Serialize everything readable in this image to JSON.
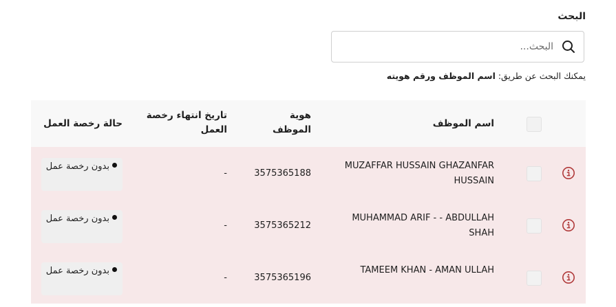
{
  "search": {
    "label": "البحث",
    "placeholder": "البحث...",
    "hint_prefix": "يمكنك البحث عن طريق: ",
    "hint_bold": "اسم الموظف ورقم هويته"
  },
  "table": {
    "headers": {
      "name": "اسم الموظف",
      "id": "هوية الموظف",
      "expiry": "تاريخ انتهاء رخصة العمل",
      "status": "حالة رخصة العمل"
    },
    "rows": [
      {
        "name": "MUZAFFAR HUSSAIN GHAZANFAR HUSSAIN",
        "id": "3575365188",
        "expiry": "-",
        "status": "بدون رخصة عمل"
      },
      {
        "name": "MUHAMMAD ARIF - - ABDULLAH SHAH",
        "id": "3575365212",
        "expiry": "-",
        "status": "بدون رخصة عمل"
      },
      {
        "name": "TAMEEM KHAN - AMAN ULLAH",
        "id": "3575365196",
        "expiry": "-",
        "status": "بدون رخصة عمل"
      }
    ]
  },
  "colors": {
    "row_highlight": "#f7e8e9",
    "info_icon": "#b03a3a",
    "header_bg": "#f8f8f8"
  },
  "icons": {
    "search": "search-icon",
    "row_warning": "info-icon",
    "status_dot": "dot-icon"
  }
}
